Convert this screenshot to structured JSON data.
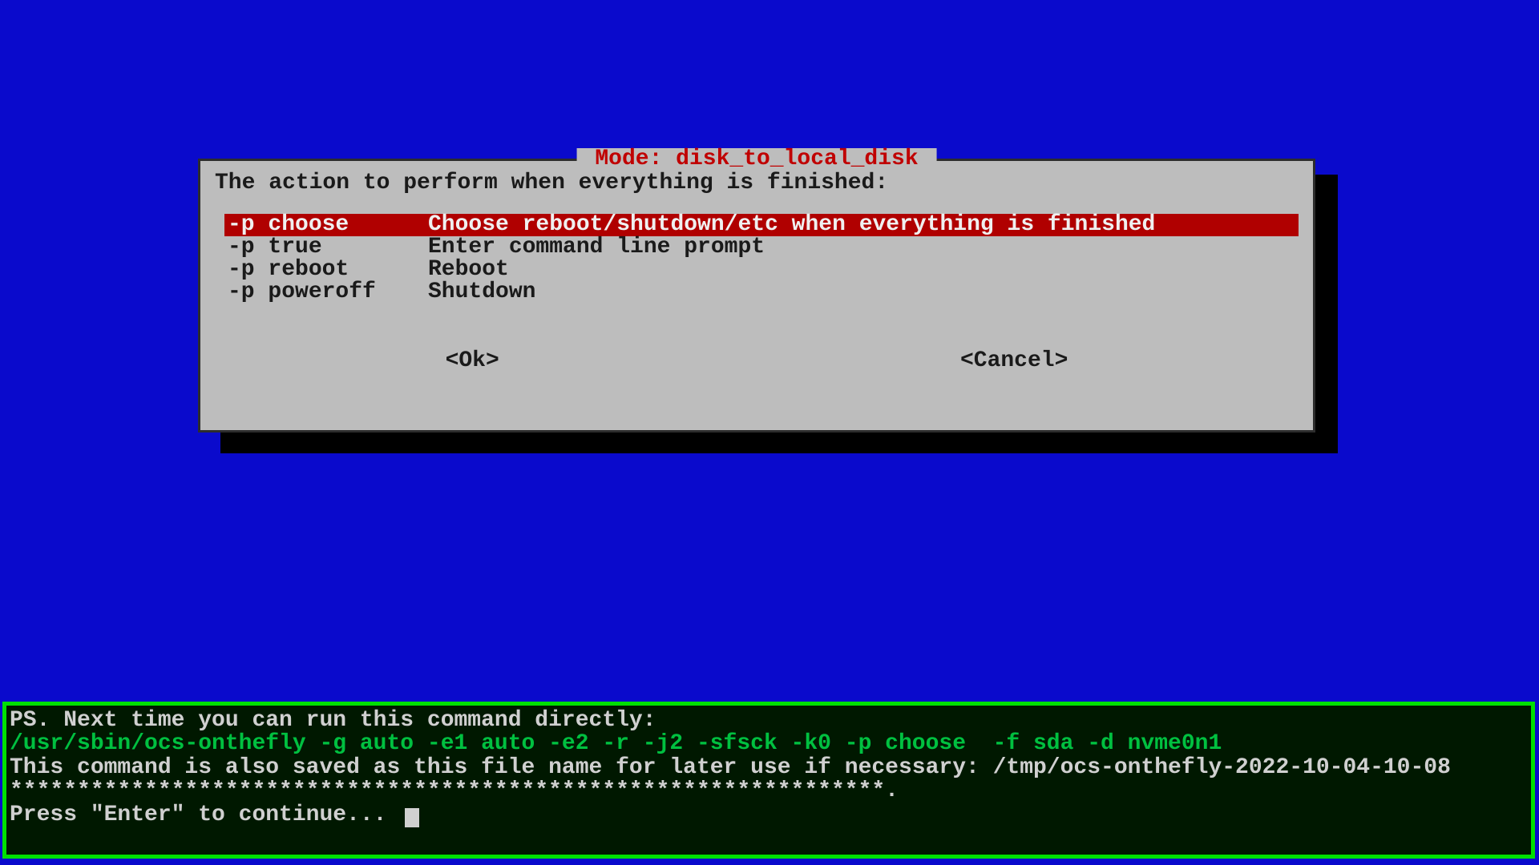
{
  "dialog": {
    "title": " Mode: disk_to_local_disk ",
    "prompt": "The action to perform when everything is finished:",
    "selected_index": 0,
    "options": [
      {
        "opt": "-p choose",
        "desc": "Choose reboot/shutdown/etc when everything is finished"
      },
      {
        "opt": "-p true",
        "desc": "Enter command line prompt"
      },
      {
        "opt": "-p reboot",
        "desc": "Reboot"
      },
      {
        "opt": "-p poweroff",
        "desc": "Shutdown"
      }
    ],
    "ok_label": "<Ok>",
    "cancel_label": "<Cancel>"
  },
  "terminal": {
    "line1": "PS. Next time you can run this command directly:",
    "line2": "/usr/sbin/ocs-onthefly -g auto -e1 auto -e2 -r -j2 -sfsck -k0 -p choose  -f sda -d nvme0n1",
    "line3": "This command is also saved as this file name for later use if necessary: /tmp/ocs-onthefly-2022-10-04-10-08",
    "line4": "*****************************************************************.",
    "line5": "Press \"Enter\" to continue... "
  }
}
